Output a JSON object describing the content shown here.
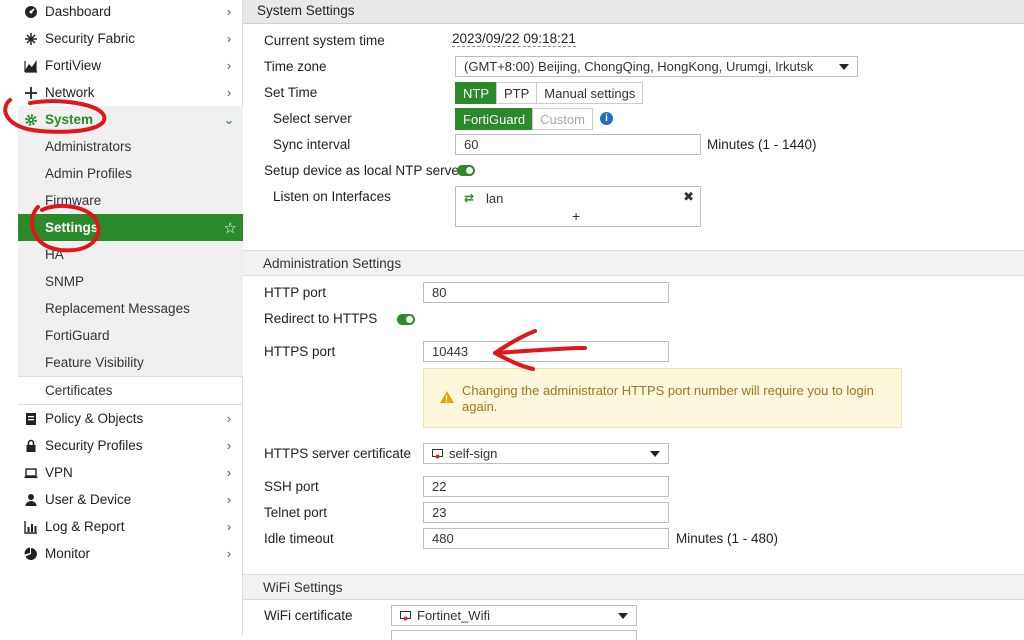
{
  "sidebar": {
    "items": [
      {
        "label": "Dashboard",
        "icon": "dashboard-icon"
      },
      {
        "label": "Security Fabric",
        "icon": "security-fabric-icon"
      },
      {
        "label": "FortiView",
        "icon": "fortiview-icon"
      },
      {
        "label": "Network",
        "icon": "network-icon"
      },
      {
        "label": "System",
        "icon": "gear-icon"
      },
      {
        "label": "Policy & Objects",
        "icon": "policy-icon"
      },
      {
        "label": "Security Profiles",
        "icon": "lock-icon"
      },
      {
        "label": "VPN",
        "icon": "vpn-icon"
      },
      {
        "label": "User & Device",
        "icon": "user-icon"
      },
      {
        "label": "Log & Report",
        "icon": "log-icon"
      },
      {
        "label": "Monitor",
        "icon": "monitor-icon"
      }
    ],
    "system_sub": [
      "Administrators",
      "Admin Profiles",
      "Firmware",
      "Settings",
      "HA",
      "SNMP",
      "Replacement Messages",
      "FortiGuard",
      "Feature Visibility",
      "Certificates"
    ]
  },
  "main": {
    "title": "System Settings",
    "current_time_label": "Current system time",
    "current_time_value": "2023/09/22 09:18:21",
    "timezone_label": "Time zone",
    "timezone_value": "(GMT+8:00) Beijing, ChongQing, HongKong, Urumgi, Irkutsk",
    "set_time_label": "Set Time",
    "set_time_options": [
      "NTP",
      "PTP",
      "Manual settings"
    ],
    "select_server_label": "Select server",
    "server_options": [
      "FortiGuard",
      "Custom"
    ],
    "sync_label": "Sync interval",
    "sync_value": "60",
    "sync_unit": "Minutes (1 - 1440)",
    "local_ntp_label": "Setup device as local NTP server",
    "listen_label": "Listen on Interfaces",
    "listen_value": "lan",
    "add_symbol": "+",
    "admin_section": "Administration Settings",
    "http_label": "HTTP port",
    "http_value": "80",
    "redirect_label": "Redirect to HTTPS",
    "https_label": "HTTPS port",
    "https_value": "10443",
    "warning_text": "Changing the administrator HTTPS port number will require you to login again.",
    "cert_label": "HTTPS server certificate",
    "cert_value": "self-sign",
    "ssh_label": "SSH port",
    "ssh_value": "22",
    "telnet_label": "Telnet port",
    "telnet_value": "23",
    "idle_label": "Idle timeout",
    "idle_value": "480",
    "idle_unit": "Minutes (1 - 480)",
    "wifi_section": "WiFi Settings",
    "wifi_cert_label": "WiFi certificate",
    "wifi_cert_value": "Fortinet_Wifi"
  },
  "colors": {
    "accent": "#2a8a2a",
    "annotation": "#e0161b",
    "warning_bg": "#fcf6dd"
  }
}
